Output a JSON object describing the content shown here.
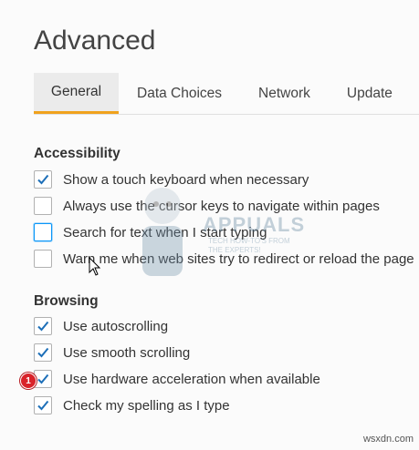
{
  "page": {
    "title": "Advanced"
  },
  "tabs": [
    {
      "label": "General",
      "selected": true
    },
    {
      "label": "Data Choices",
      "selected": false
    },
    {
      "label": "Network",
      "selected": false
    },
    {
      "label": "Update",
      "selected": false
    }
  ],
  "accessibility": {
    "title": "Accessibility",
    "options": [
      {
        "label": "Show a touch keyboard when necessary",
        "checked": true
      },
      {
        "label": "Always use the cursor keys to navigate within pages",
        "checked": false
      },
      {
        "label": "Search for text when I start typing",
        "checked": false
      },
      {
        "label": "Warn me when web sites try to redirect or reload the page",
        "checked": false
      }
    ]
  },
  "browsing": {
    "title": "Browsing",
    "options": [
      {
        "label": "Use autoscrolling",
        "checked": true
      },
      {
        "label": "Use smooth scrolling",
        "checked": true
      },
      {
        "label": "Use hardware acceleration when available",
        "checked": true
      },
      {
        "label": "Check my spelling as I type",
        "checked": true
      }
    ]
  },
  "annotation": {
    "badge": "1"
  },
  "watermark": {
    "brand": "APPUALS",
    "tagline1": "TECH HOW-TO'S FROM",
    "tagline2": "THE EXPERTS!"
  },
  "footer": {
    "site": "wsxdn.com"
  },
  "colors": {
    "accent_tab": "#f0a21d",
    "check": "#1d6fb8",
    "focus": "#0996f8",
    "badge": "#d9232a"
  }
}
